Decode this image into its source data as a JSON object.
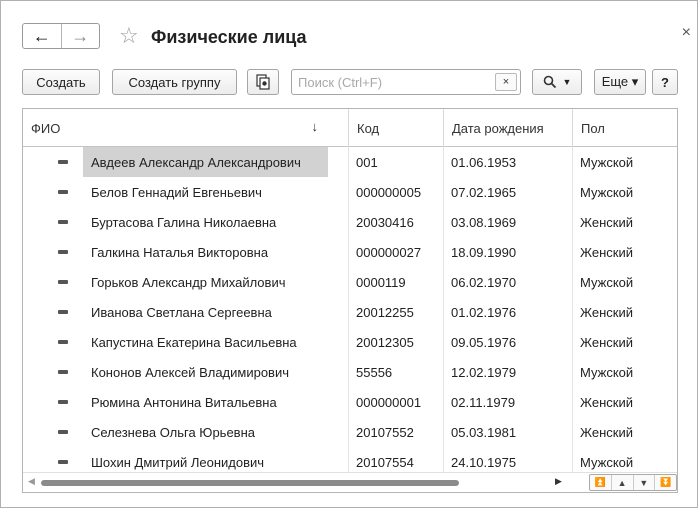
{
  "window": {
    "title": "Физические лица"
  },
  "nav": {
    "back_glyph": "←",
    "forward_glyph": "→",
    "favorite_glyph": "☆",
    "close_glyph": "×"
  },
  "toolbar": {
    "create_label": "Создать",
    "create_group_label": "Создать группу",
    "search_placeholder": "Поиск (Ctrl+F)",
    "search_value": "",
    "clear_glyph": "×",
    "search_button_glyph": "🔍 ▾",
    "more_label": "Еще ▾",
    "help_label": "?"
  },
  "table": {
    "columns": [
      {
        "label": "ФИО"
      },
      {
        "label": "Код"
      },
      {
        "label": "Дата рождения"
      },
      {
        "label": "Пол"
      }
    ],
    "sort_glyph": "↓",
    "rows": [
      {
        "name": "Авдеев Александр Александрович",
        "code": "001",
        "birth": "01.06.1953",
        "sex": "Мужской"
      },
      {
        "name": "Белов Геннадий Евгеньевич",
        "code": "000000005",
        "birth": "07.02.1965",
        "sex": "Мужской"
      },
      {
        "name": "Буртасова Галина Николаевна",
        "code": "20030416",
        "birth": "03.08.1969",
        "sex": "Женский"
      },
      {
        "name": "Галкина Наталья Викторовна",
        "code": "000000027",
        "birth": "18.09.1990",
        "sex": "Женский"
      },
      {
        "name": "Горьков Александр Михайлович",
        "code": "0000119",
        "birth": "06.02.1970",
        "sex": "Мужской"
      },
      {
        "name": "Иванова Светлана Сергеевна",
        "code": "20012255",
        "birth": "01.02.1976",
        "sex": "Женский"
      },
      {
        "name": "Капустина Екатерина Васильевна",
        "code": "20012305",
        "birth": "09.05.1976",
        "sex": "Женский"
      },
      {
        "name": "Кононов Алексей Владимирович",
        "code": "55556",
        "birth": "12.02.1979",
        "sex": "Мужской"
      },
      {
        "name": "Рюмина Антонина Витальевна",
        "code": "000000001",
        "birth": "02.11.1979",
        "sex": "Женский"
      },
      {
        "name": "Селезнева Ольга Юрьевна",
        "code": "20107552",
        "birth": "05.03.1981",
        "sex": "Женский"
      },
      {
        "name": "Шохин Дмитрий Леонидович",
        "code": "20107554",
        "birth": "24.10.1975",
        "sex": "Мужской"
      }
    ],
    "selected_row": 0
  },
  "pager": {
    "first": "⏫",
    "prev": "▲",
    "next": "▼",
    "last": "⏬"
  },
  "icons": {
    "row_icon": "dash-element-icon",
    "copy_icon": "copy-icon"
  }
}
